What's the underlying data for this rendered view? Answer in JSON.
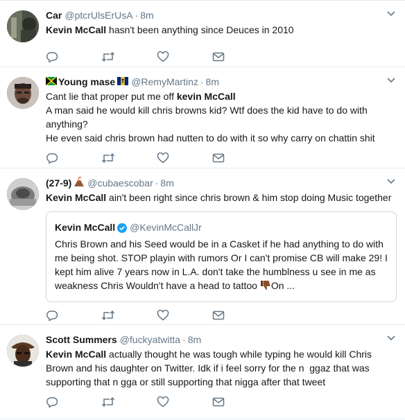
{
  "tweets": [
    {
      "name": "Car",
      "handle": "@ptcrUlsErUsA",
      "dot": "·",
      "time": "8m",
      "lines": [
        {
          "bold": "Kevin McCall",
          "rest": " hasn't been anything since Deuces in 2010"
        }
      ]
    },
    {
      "name": "Young mase",
      "handle": "@RemyMartinz",
      "dot": "·",
      "time": "8m",
      "lines": [
        {
          "pre": "Cant lie that proper put me off ",
          "bold": "kevin McCall"
        },
        {
          "rest": "A man said he would kill chris browns kid? Wtf does the kid have to do with anything?"
        },
        {
          "rest": "He even said chris brown had nutten to do with it so why carry on chattin shit"
        }
      ]
    },
    {
      "name": "(27-9)",
      "handle": "@cubaescobar",
      "dot": "·",
      "time": "8m",
      "lines": [
        {
          "bold": "Kevin McCall",
          "rest": " ain't been right since chris brown & him stop doing Music together"
        }
      ],
      "quote": {
        "name": "Kevin McCall",
        "handle": "@KevinMcCallJr",
        "text": "Chris Brown and his Seed would be in a Casket if he had anything to do with me being shot. STOP playin with rumors Or I can't promise CB will make 29! I kept him alive 7 years now in L.A. don't take the humblness u see in me as weakness Chris Wouldn't have a head to tattoo",
        "text_end": "On ..."
      }
    },
    {
      "name": "Scott Summers",
      "handle": "@fuckyatwitta",
      "dot": "·",
      "time": "8m",
      "lines": [
        {
          "bold": "Kevin McCall",
          "rest": " actually thought he was tough while typing he would kill Chris Brown and his daughter on Twitter. Idk if i feel sorry for the n  ggaz that was supporting that n gga or still supporting that nigga after that tweet"
        }
      ]
    }
  ],
  "icons": {
    "reply": "reply-icon",
    "retweet": "retweet-icon",
    "like": "heart-icon",
    "dm": "envelope-icon",
    "caret": "chevron-down-icon"
  },
  "colors": {
    "icon": "#657786",
    "border": "#e6ecf0",
    "text": "#14171a",
    "verified": "#1da1f2"
  }
}
